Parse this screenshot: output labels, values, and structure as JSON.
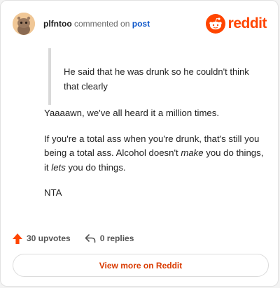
{
  "header": {
    "username": "plfntoo",
    "action_text": "commented on",
    "post_link": "post",
    "brand": "reddit",
    "brand_color": "#ff4500"
  },
  "quote": {
    "text": "He said that he was drunk so he couldn't think that clearly"
  },
  "comment": {
    "p1": "Yaaaawn, we've all heard it a million times.",
    "p2_a": "If you're a total ass when you're drunk, that's still you being a total ass. Alcohol doesn't ",
    "p2_em1": "make",
    "p2_b": " you do things, it ",
    "p2_em2": "lets",
    "p2_c": " you do things.",
    "p3": "NTA"
  },
  "footer": {
    "upvotes": "30 upvotes",
    "replies": "0 replies",
    "upvote_icon": "upvote-arrow-icon",
    "reply_icon": "reply-arrow-icon",
    "upvote_color": "#ff4500"
  },
  "cta": {
    "label": "View more on Reddit",
    "color": "#d93a00"
  }
}
